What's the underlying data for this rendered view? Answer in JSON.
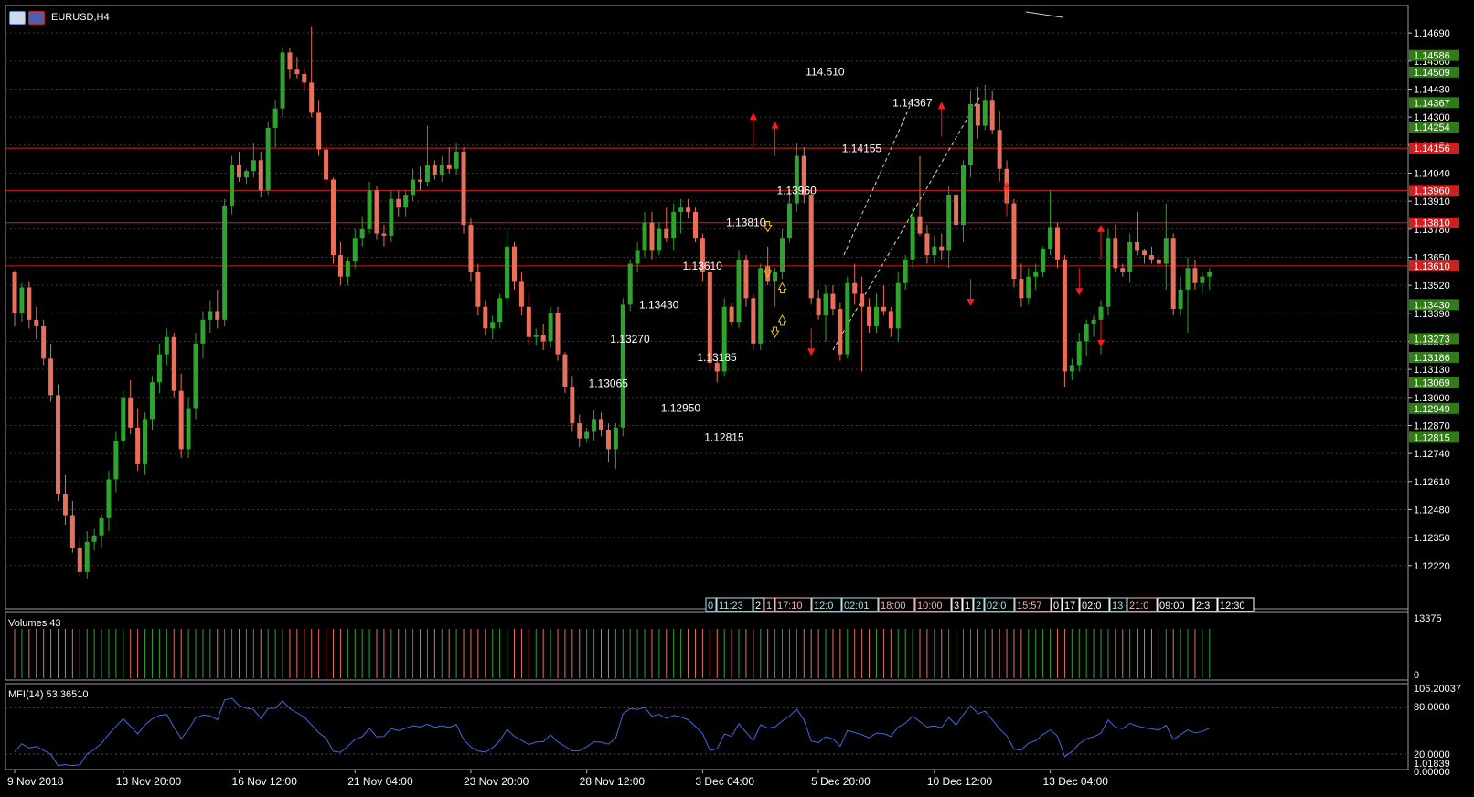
{
  "symbol_label": "EURUSD,H4",
  "colors": {
    "background": "#000000",
    "bull": "#2ea32e",
    "bear": "#e8705a",
    "grid": "#3a3a3a",
    "axis": "#bfbfbf",
    "level_line": "#d11f1f",
    "label_green": "#2f7d14",
    "label_red": "#d11f1f",
    "mfi_line": "#4169e1",
    "trend_line": "#d8d8b0",
    "arrow_red": "#ff1a1a",
    "arrow_yellow": "#f0c000",
    "time_box_cyan": "#9fe8ef",
    "time_box_pink": "#f3b5b5",
    "time_box_white": "#ffffff"
  },
  "price_axis_ticks": [
    "1.14690",
    "1.14560",
    "1.14430",
    "1.14300",
    "1.14170",
    "1.14040",
    "1.13910",
    "1.13780",
    "1.13650",
    "1.13520",
    "1.13390",
    "1.13260",
    "1.13130",
    "1.13000",
    "1.12870",
    "1.12740",
    "1.12610",
    "1.12480",
    "1.12350",
    "1.12220"
  ],
  "price_axis_labels": [
    {
      "text": "1.14586",
      "price": 1.14586,
      "color": "green"
    },
    {
      "text": "1.14509",
      "price": 1.14509,
      "color": "green"
    },
    {
      "text": "1.14367",
      "price": 1.14367,
      "color": "green"
    },
    {
      "text": "1.14254",
      "price": 1.14254,
      "color": "green"
    },
    {
      "text": "1.14156",
      "price": 1.14156,
      "color": "red"
    },
    {
      "text": "1.13960",
      "price": 1.1396,
      "color": "red"
    },
    {
      "text": "1.13810",
      "price": 1.1381,
      "color": "red"
    },
    {
      "text": "1.13610",
      "price": 1.1361,
      "color": "red"
    },
    {
      "text": "1.13430",
      "price": 1.1343,
      "color": "green"
    },
    {
      "text": "1.13273",
      "price": 1.13273,
      "color": "green"
    },
    {
      "text": "1.13186",
      "price": 1.13186,
      "color": "green"
    },
    {
      "text": "1.13069",
      "price": 1.13069,
      "color": "green"
    },
    {
      "text": "1.12949",
      "price": 1.12949,
      "color": "green"
    },
    {
      "text": "1.12815",
      "price": 1.12815,
      "color": "green"
    }
  ],
  "level_lines": [
    1.14156,
    1.1396,
    1.1381,
    1.1361
  ],
  "chart_annotations": [
    {
      "text": "114.510",
      "bar": 111,
      "price": 1.1451
    },
    {
      "text": "1.14367",
      "bar": 123,
      "price": 1.14367
    },
    {
      "text": "1.14155",
      "bar": 116,
      "price": 1.14155
    },
    {
      "text": "1.13960",
      "bar": 107,
      "price": 1.1396
    },
    {
      "text": "1.13810",
      "bar": 100,
      "price": 1.1381
    },
    {
      "text": "1.13610",
      "bar": 94,
      "price": 1.1361
    },
    {
      "text": "1.13430",
      "bar": 88,
      "price": 1.1343
    },
    {
      "text": "1.13270",
      "bar": 84,
      "price": 1.1327
    },
    {
      "text": "1.13185",
      "bar": 96,
      "price": 1.13185
    },
    {
      "text": "1.13065",
      "bar": 81,
      "price": 1.13065
    },
    {
      "text": "1.12950",
      "bar": 91,
      "price": 1.1295
    },
    {
      "text": "1.12815",
      "bar": 97,
      "price": 1.12815
    }
  ],
  "time_boxes": [
    {
      "text": "0",
      "color": "cyan"
    },
    {
      "text": "11:23",
      "color": "cyan"
    },
    {
      "text": "2",
      "color": "white"
    },
    {
      "text": "1",
      "color": "pink"
    },
    {
      "text": "17:10",
      "color": "pink"
    },
    {
      "text": "12:0",
      "color": "cyan"
    },
    {
      "text": "02:01",
      "color": "cyan"
    },
    {
      "text": "18:00",
      "color": "pink"
    },
    {
      "text": "10:00",
      "color": "pink"
    },
    {
      "text": "3",
      "color": "white"
    },
    {
      "text": "1",
      "color": "white"
    },
    {
      "text": "2",
      "color": "cyan"
    },
    {
      "text": "02:0",
      "color": "cyan"
    },
    {
      "text": "15:57",
      "color": "pink"
    },
    {
      "text": "0",
      "color": "white"
    },
    {
      "text": "17",
      "color": "white"
    },
    {
      "text": "02:0",
      "color": "white"
    },
    {
      "text": "13",
      "color": "cyan"
    },
    {
      "text": "21:0",
      "color": "pink"
    },
    {
      "text": "09:00",
      "color": "white"
    },
    {
      "text": "2:3",
      "color": "white"
    },
    {
      "text": "12:30",
      "color": "white"
    }
  ],
  "volumes_title": "Volumes 43",
  "volume_axis": [
    "13375",
    "0"
  ],
  "mfi_title": "MFI(14) 53.36510",
  "mfi_axis": [
    "106.20037",
    "80.0000",
    "20.0000",
    "1.01839",
    "0.00000"
  ],
  "time_axis_labels": [
    {
      "text": "9 Nov 2018",
      "bar": 0
    },
    {
      "text": "13 Nov 20:00",
      "bar": 15
    },
    {
      "text": "16 Nov 12:00",
      "bar": 31
    },
    {
      "text": "21 Nov 04:00",
      "bar": 47
    },
    {
      "text": "23 Nov 20:00",
      "bar": 63
    },
    {
      "text": "28 Nov 12:00",
      "bar": 79
    },
    {
      "text": "3 Dec 04:00",
      "bar": 95
    },
    {
      "text": "5 Dec 20:00",
      "bar": 111
    },
    {
      "text": "10 Dec 12:00",
      "bar": 127
    },
    {
      "text": "13 Dec 04:00",
      "bar": 143
    }
  ],
  "chart_data": {
    "type": "candlestick",
    "title": "EURUSD,H4",
    "ylim": [
      1.1213,
      1.1475
    ],
    "candles": [
      [
        1.1358,
        1.1359,
        1.1333,
        1.1339
      ],
      [
        1.1339,
        1.1353,
        1.1335,
        1.1351
      ],
      [
        1.1351,
        1.1354,
        1.1332,
        1.1336
      ],
      [
        1.1336,
        1.1342,
        1.1327,
        1.1333
      ],
      [
        1.1333,
        1.1336,
        1.1315,
        1.1318
      ],
      [
        1.1318,
        1.1325,
        1.1298,
        1.1301
      ],
      [
        1.1301,
        1.1306,
        1.1252,
        1.1255
      ],
      [
        1.1255,
        1.1264,
        1.1241,
        1.1245
      ],
      [
        1.1245,
        1.1252,
        1.1228,
        1.123
      ],
      [
        1.123,
        1.1234,
        1.1217,
        1.1219
      ],
      [
        1.1219,
        1.1238,
        1.1216,
        1.1233
      ],
      [
        1.1233,
        1.1239,
        1.1229,
        1.1236
      ],
      [
        1.1236,
        1.1246,
        1.123,
        1.1244
      ],
      [
        1.1244,
        1.1266,
        1.1238,
        1.1262
      ],
      [
        1.1262,
        1.1284,
        1.1256,
        1.128
      ],
      [
        1.128,
        1.1303,
        1.1276,
        1.13
      ],
      [
        1.13,
        1.1308,
        1.1283,
        1.1286
      ],
      [
        1.1286,
        1.1295,
        1.1266,
        1.1269
      ],
      [
        1.1269,
        1.1293,
        1.1264,
        1.129
      ],
      [
        1.129,
        1.131,
        1.1285,
        1.1307
      ],
      [
        1.1307,
        1.1325,
        1.1302,
        1.132
      ],
      [
        1.132,
        1.1332,
        1.1315,
        1.1328
      ],
      [
        1.1328,
        1.133,
        1.13,
        1.1303
      ],
      [
        1.1303,
        1.1311,
        1.1272,
        1.1276
      ],
      [
        1.1276,
        1.13,
        1.1272,
        1.1295
      ],
      [
        1.1295,
        1.133,
        1.129,
        1.1325
      ],
      [
        1.1325,
        1.134,
        1.1318,
        1.1336
      ],
      [
        1.1336,
        1.1345,
        1.133,
        1.134
      ],
      [
        1.134,
        1.135,
        1.1332,
        1.1336
      ],
      [
        1.1336,
        1.1392,
        1.1333,
        1.1389
      ],
      [
        1.1389,
        1.1412,
        1.1385,
        1.1408
      ],
      [
        1.1408,
        1.1414,
        1.14,
        1.1402
      ],
      [
        1.1402,
        1.1406,
        1.1399,
        1.1405
      ],
      [
        1.1405,
        1.1418,
        1.1402,
        1.141
      ],
      [
        1.141,
        1.1414,
        1.1393,
        1.1396
      ],
      [
        1.1396,
        1.1428,
        1.1394,
        1.1425
      ],
      [
        1.1425,
        1.1438,
        1.1416,
        1.1434
      ],
      [
        1.1434,
        1.1462,
        1.143,
        1.146
      ],
      [
        1.146,
        1.1462,
        1.1448,
        1.1452
      ],
      [
        1.1452,
        1.1458,
        1.1448,
        1.145
      ],
      [
        1.145,
        1.1453,
        1.1442,
        1.1446
      ],
      [
        1.1446,
        1.1472,
        1.143,
        1.1432
      ],
      [
        1.1432,
        1.1438,
        1.1412,
        1.1415
      ],
      [
        1.1415,
        1.1418,
        1.1398,
        1.1401
      ],
      [
        1.1401,
        1.1402,
        1.1362,
        1.1366
      ],
      [
        1.1366,
        1.1372,
        1.1352,
        1.1356
      ],
      [
        1.1356,
        1.1365,
        1.1352,
        1.1363
      ],
      [
        1.1363,
        1.1378,
        1.136,
        1.1374
      ],
      [
        1.1374,
        1.1384,
        1.137,
        1.1378
      ],
      [
        1.1378,
        1.14,
        1.1376,
        1.1396
      ],
      [
        1.1396,
        1.1398,
        1.1373,
        1.1376
      ],
      [
        1.1376,
        1.138,
        1.137,
        1.1375
      ],
      [
        1.1375,
        1.1396,
        1.1372,
        1.1392
      ],
      [
        1.1392,
        1.1396,
        1.1384,
        1.1388
      ],
      [
        1.1388,
        1.1396,
        1.1384,
        1.1394
      ],
      [
        1.1394,
        1.1406,
        1.1391,
        1.1401
      ],
      [
        1.1401,
        1.1407,
        1.1396,
        1.14
      ],
      [
        1.14,
        1.1426,
        1.1398,
        1.1408
      ],
      [
        1.1408,
        1.141,
        1.1401,
        1.1403
      ],
      [
        1.1403,
        1.1412,
        1.14,
        1.1408
      ],
      [
        1.1408,
        1.1416,
        1.1404,
        1.1406
      ],
      [
        1.1406,
        1.1418,
        1.1403,
        1.1414
      ],
      [
        1.1414,
        1.1416,
        1.1376,
        1.138
      ],
      [
        1.138,
        1.1383,
        1.1354,
        1.1358
      ],
      [
        1.1358,
        1.1362,
        1.1338,
        1.1342
      ],
      [
        1.1342,
        1.1345,
        1.1329,
        1.1332
      ],
      [
        1.1332,
        1.1338,
        1.1327,
        1.1335
      ],
      [
        1.1335,
        1.1348,
        1.1332,
        1.1346
      ],
      [
        1.1346,
        1.1378,
        1.1342,
        1.137
      ],
      [
        1.137,
        1.1372,
        1.135,
        1.1354
      ],
      [
        1.1354,
        1.1358,
        1.1338,
        1.1342
      ],
      [
        1.1342,
        1.1348,
        1.1324,
        1.1328
      ],
      [
        1.1328,
        1.1332,
        1.1324,
        1.1329
      ],
      [
        1.1329,
        1.1334,
        1.1322,
        1.1326
      ],
      [
        1.1326,
        1.1342,
        1.1323,
        1.1339
      ],
      [
        1.1339,
        1.1342,
        1.1317,
        1.132
      ],
      [
        1.132,
        1.1321,
        1.1302,
        1.1305
      ],
      [
        1.1305,
        1.131,
        1.1284,
        1.1288
      ],
      [
        1.1288,
        1.1292,
        1.1277,
        1.1281
      ],
      [
        1.1281,
        1.1286,
        1.1279,
        1.1284
      ],
      [
        1.1284,
        1.1294,
        1.128,
        1.129
      ],
      [
        1.129,
        1.1293,
        1.1282,
        1.1285
      ],
      [
        1.1285,
        1.1288,
        1.127,
        1.1276
      ],
      [
        1.1276,
        1.1288,
        1.1267,
        1.1286
      ],
      [
        1.1286,
        1.1346,
        1.1282,
        1.1343
      ],
      [
        1.1343,
        1.1364,
        1.134,
        1.1362
      ],
      [
        1.1362,
        1.1372,
        1.1358,
        1.1368
      ],
      [
        1.1368,
        1.1386,
        1.1365,
        1.1381
      ],
      [
        1.1381,
        1.1386,
        1.1364,
        1.1368
      ],
      [
        1.1368,
        1.1381,
        1.1366,
        1.1378
      ],
      [
        1.1378,
        1.1388,
        1.1372,
        1.1374
      ],
      [
        1.1374,
        1.139,
        1.1368,
        1.1386
      ],
      [
        1.1386,
        1.1392,
        1.1376,
        1.1388
      ],
      [
        1.1388,
        1.1392,
        1.1383,
        1.1386
      ],
      [
        1.1386,
        1.1388,
        1.1372,
        1.1374
      ],
      [
        1.1374,
        1.1376,
        1.1354,
        1.1358
      ],
      [
        1.1358,
        1.1362,
        1.1313,
        1.1316
      ],
      [
        1.1316,
        1.1318,
        1.1307,
        1.1312
      ],
      [
        1.1312,
        1.1346,
        1.131,
        1.1342
      ],
      [
        1.1342,
        1.1344,
        1.1333,
        1.1335
      ],
      [
        1.1335,
        1.1368,
        1.1332,
        1.1364
      ],
      [
        1.1364,
        1.1366,
        1.1342,
        1.1346
      ],
      [
        1.1346,
        1.1348,
        1.1322,
        1.1325
      ],
      [
        1.1325,
        1.1362,
        1.1322,
        1.136
      ],
      [
        1.136,
        1.137,
        1.1352,
        1.1354
      ],
      [
        1.1354,
        1.136,
        1.1342,
        1.1358
      ],
      [
        1.1358,
        1.1378,
        1.1355,
        1.1374
      ],
      [
        1.1374,
        1.1396,
        1.1372,
        1.139
      ],
      [
        1.139,
        1.1418,
        1.1386,
        1.1412
      ],
      [
        1.1412,
        1.1416,
        1.139,
        1.1394
      ],
      [
        1.1394,
        1.1396,
        1.1343,
        1.1346
      ],
      [
        1.1346,
        1.135,
        1.1336,
        1.1338
      ],
      [
        1.1338,
        1.1352,
        1.1326,
        1.1348
      ],
      [
        1.1348,
        1.1352,
        1.1338,
        1.1341
      ],
      [
        1.1341,
        1.1344,
        1.1317,
        1.132
      ],
      [
        1.132,
        1.1356,
        1.1318,
        1.1353
      ],
      [
        1.1353,
        1.1362,
        1.1343,
        1.1348
      ],
      [
        1.1348,
        1.1356,
        1.1312,
        1.1342
      ],
      [
        1.1342,
        1.1346,
        1.133,
        1.1333
      ],
      [
        1.1333,
        1.1348,
        1.133,
        1.1342
      ],
      [
        1.1342,
        1.1352,
        1.1338,
        1.134
      ],
      [
        1.134,
        1.1342,
        1.1328,
        1.1332
      ],
      [
        1.1332,
        1.1358,
        1.1326,
        1.1353
      ],
      [
        1.1353,
        1.1366,
        1.135,
        1.1364
      ],
      [
        1.1364,
        1.1388,
        1.136,
        1.1384
      ],
      [
        1.1384,
        1.1412,
        1.1375,
        1.1376
      ],
      [
        1.1376,
        1.138,
        1.1362,
        1.1366
      ],
      [
        1.1366,
        1.1375,
        1.1362,
        1.137
      ],
      [
        1.137,
        1.1376,
        1.1364,
        1.1368
      ],
      [
        1.1368,
        1.1398,
        1.136,
        1.1394
      ],
      [
        1.1394,
        1.1406,
        1.1378,
        1.138
      ],
      [
        1.138,
        1.141,
        1.1372,
        1.1408
      ],
      [
        1.1408,
        1.1442,
        1.1402,
        1.1436
      ],
      [
        1.1436,
        1.1444,
        1.142,
        1.1426
      ],
      [
        1.1426,
        1.1445,
        1.1424,
        1.1438
      ],
      [
        1.1438,
        1.1442,
        1.1422,
        1.1424
      ],
      [
        1.1424,
        1.1433,
        1.14,
        1.1406
      ],
      [
        1.1406,
        1.141,
        1.1388,
        1.139
      ],
      [
        1.139,
        1.1392,
        1.1351,
        1.1355
      ],
      [
        1.1355,
        1.1362,
        1.1342,
        1.1346
      ],
      [
        1.1346,
        1.136,
        1.1343,
        1.1356
      ],
      [
        1.1356,
        1.1362,
        1.135,
        1.1358
      ],
      [
        1.1358,
        1.137,
        1.1356,
        1.1369
      ],
      [
        1.1369,
        1.1396,
        1.1366,
        1.1379
      ],
      [
        1.1379,
        1.1381,
        1.136,
        1.1364
      ],
      [
        1.1364,
        1.1366,
        1.1305,
        1.1312
      ],
      [
        1.1312,
        1.1318,
        1.1308,
        1.1315
      ],
      [
        1.1315,
        1.133,
        1.1312,
        1.1326
      ],
      [
        1.1326,
        1.1336,
        1.1319,
        1.1334
      ],
      [
        1.1334,
        1.1338,
        1.1328,
        1.1336
      ],
      [
        1.1336,
        1.1345,
        1.132,
        1.1342
      ],
      [
        1.1342,
        1.1378,
        1.1338,
        1.1374
      ],
      [
        1.1374,
        1.138,
        1.1358,
        1.136
      ],
      [
        1.136,
        1.1362,
        1.1356,
        1.1358
      ],
      [
        1.1358,
        1.1376,
        1.1353,
        1.1372
      ],
      [
        1.1372,
        1.1386,
        1.1366,
        1.1368
      ],
      [
        1.1368,
        1.1369,
        1.1362,
        1.1366
      ],
      [
        1.1366,
        1.137,
        1.1362,
        1.1364
      ],
      [
        1.1364,
        1.1366,
        1.1358,
        1.1362
      ],
      [
        1.1362,
        1.139,
        1.135,
        1.1374
      ],
      [
        1.1374,
        1.1376,
        1.1338,
        1.1341
      ],
      [
        1.1341,
        1.1356,
        1.1338,
        1.135
      ],
      [
        1.135,
        1.1365,
        1.133,
        1.136
      ],
      [
        1.136,
        1.1364,
        1.135,
        1.1353
      ],
      [
        1.1353,
        1.1358,
        1.1348,
        1.1356
      ],
      [
        1.1356,
        1.136,
        1.135,
        1.1358
      ]
    ],
    "volume_max": 13375,
    "mfi_range": [
      0,
      106.20037
    ],
    "mfi_levels": [
      80,
      20
    ],
    "mfi_last": 53.3651
  }
}
